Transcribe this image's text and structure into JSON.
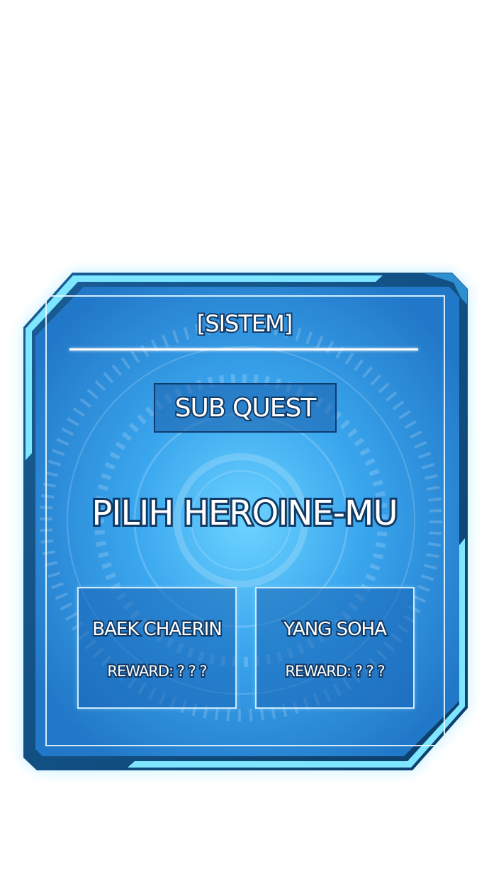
{
  "system_title": "[SISTEM]",
  "quest_type": "SUB QUEST",
  "quest_title": "PILIH HEROINE-MU",
  "options": [
    {
      "name": "BAEK CHAERIN",
      "reward": "REWARD: ? ? ?"
    },
    {
      "name": "YANG SOHA",
      "reward": "REWARD: ? ? ?"
    }
  ],
  "colors": {
    "background": "#ffffff",
    "panel_fill": "#3aa4ec",
    "frame_dark": "#0f4a7a",
    "frame_light": "#6fe0ff",
    "text": "#ffffff",
    "text_outline": "#123a66"
  }
}
